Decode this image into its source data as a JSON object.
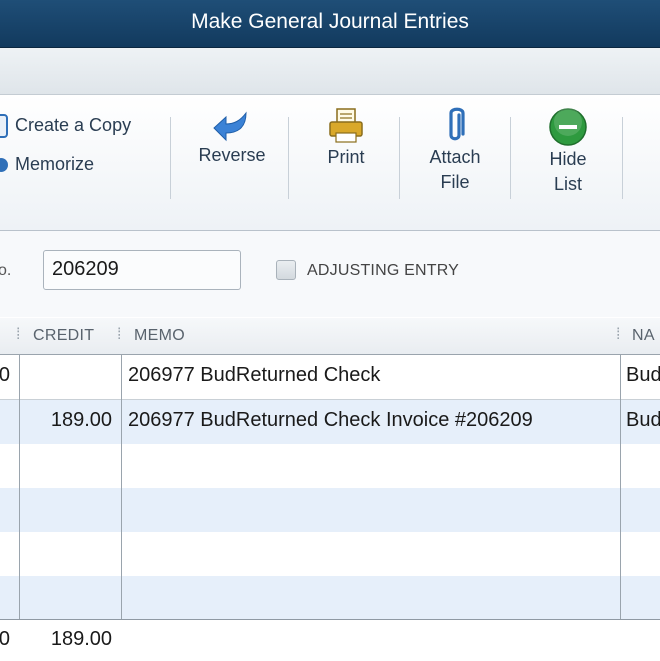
{
  "window": {
    "title": "Make General Journal Entries"
  },
  "toolbar": {
    "create_copy": "Create a Copy",
    "memorize": "Memorize",
    "reverse": "Reverse",
    "print": "Print",
    "attach_line1": "Attach",
    "attach_line2": "File",
    "hide_line1": "Hide",
    "hide_line2": "List"
  },
  "form": {
    "entry_no_label": "o.",
    "entry_no_value": "206209",
    "adjusting_entry_label": "ADJUSTING ENTRY",
    "adjusting_entry_checked": false
  },
  "grid": {
    "columns": {
      "credit": "CREDIT",
      "memo": "MEMO",
      "name": "NA"
    },
    "rows": [
      {
        "debit": "0",
        "credit": "",
        "memo": "206977 BudReturned Check",
        "name": "Bud"
      },
      {
        "debit": "",
        "credit": "189.00",
        "memo": "206977 BudReturned Check Invoice #206209",
        "name": "Bud"
      },
      {
        "debit": "",
        "credit": "",
        "memo": "",
        "name": ""
      },
      {
        "debit": "",
        "credit": "",
        "memo": "",
        "name": ""
      },
      {
        "debit": "",
        "credit": "",
        "memo": "",
        "name": ""
      },
      {
        "debit": "",
        "credit": "",
        "memo": "",
        "name": ""
      }
    ],
    "totals": {
      "debit": "0",
      "credit": "189.00"
    }
  },
  "colors": {
    "titlebar": "#1f4e77",
    "alt_row": "#e6effa",
    "reverse_icon": "#3b82d6",
    "hide_icon": "#2e9a3f"
  }
}
